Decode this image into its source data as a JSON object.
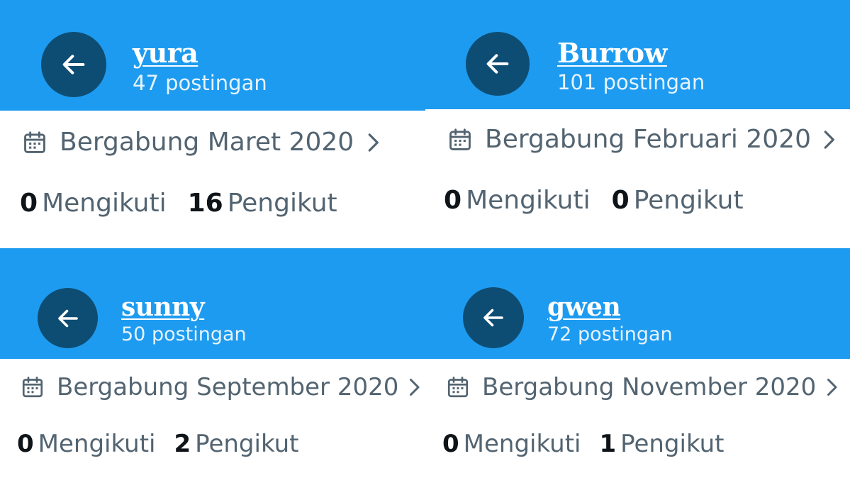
{
  "colors": {
    "header": "#1d9bf0",
    "back_button": "#0e4d73",
    "text_secondary": "#536471",
    "text_primary": "#0f1419"
  },
  "icons": {
    "back": "arrow-left-icon",
    "calendar": "calendar-icon",
    "chevron": "chevron-right-icon"
  },
  "profiles": [
    {
      "name": "yura",
      "posts": "47 postingan",
      "joined": "Bergabung Maret 2020",
      "following_count": "0",
      "following_label": "Mengikuti",
      "followers_count": "16",
      "followers_label": "Pengikut"
    },
    {
      "name": "Burrow",
      "posts": "101 postingan",
      "joined": "Bergabung Februari 2020",
      "following_count": "0",
      "following_label": "Mengikuti",
      "followers_count": "0",
      "followers_label": "Pengikut"
    },
    {
      "name": "sunny",
      "posts": "50 postingan",
      "joined": "Bergabung September 2020",
      "following_count": "0",
      "following_label": "Mengikuti",
      "followers_count": "2",
      "followers_label": "Pengikut"
    },
    {
      "name": "gwen",
      "posts": "72 postingan",
      "joined": "Bergabung November 2020",
      "following_count": "0",
      "following_label": "Mengikuti",
      "followers_count": "1",
      "followers_label": "Pengikut"
    }
  ]
}
